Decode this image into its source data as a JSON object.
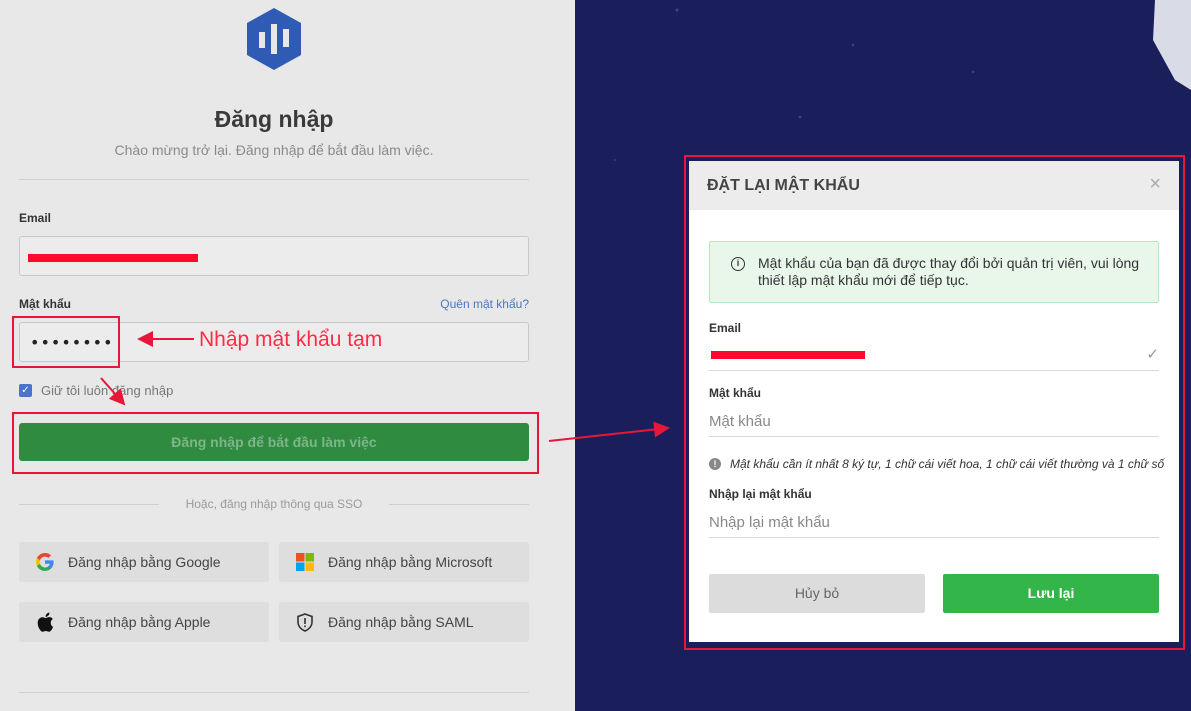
{
  "login": {
    "title": "Đăng nhập",
    "subtitle": "Chào mừng trở lại. Đăng nhập để bắt đầu làm việc.",
    "email_label": "Email",
    "email_value": "",
    "password_label": "Mật khẩu",
    "password_value": "••••••••",
    "forgot_link": "Quên mật khẩu?",
    "remember_label": "Giữ tôi luôn đăng nhập",
    "remember_checked": true,
    "submit_label": "Đăng nhập để bắt đầu làm việc",
    "or_sso": "Hoặc, đăng nhập thông qua SSO",
    "sso": {
      "google": "Đăng nhập bằng Google",
      "microsoft": "Đăng nhập bằng Microsoft",
      "apple": "Đăng nhập bằng Apple",
      "saml": "Đăng nhập bằng SAML"
    }
  },
  "annotation": {
    "text": "Nhập mật khẩu tạm",
    "color": "#e8173a"
  },
  "modal": {
    "title": "ĐẶT LẠI MẬT KHẨU",
    "close": "×",
    "notice": "Mật khẩu của bạn đã được thay đổi bởi quản trị viên, vui lòng thiết lập mật khẩu mới để tiếp tục.",
    "email_label": "Email",
    "password_label": "Mật khẩu",
    "password_placeholder": "Mật khẩu",
    "password_hint": "Mật khẩu cần ít nhất 8 ký tự, 1 chữ cái viết hoa, 1 chữ cái viết thường và 1 chữ số",
    "confirm_label": "Nhập lại mật khẩu",
    "confirm_placeholder": "Nhập lại mật khẩu",
    "cancel_label": "Hủy bỏ",
    "save_label": "Lưu lại"
  },
  "colors": {
    "primary_green": "#34b54a",
    "dark_panel": "#1a1f5c",
    "brand_blue": "#2f5bb5"
  }
}
